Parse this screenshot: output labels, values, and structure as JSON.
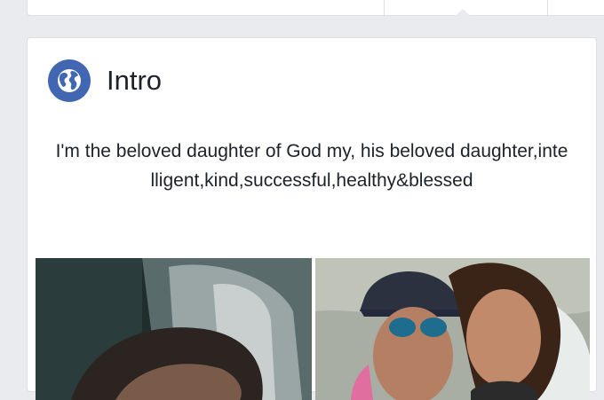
{
  "top_bar": {
    "active_tab_caret": true
  },
  "intro": {
    "title": "Intro",
    "icon": "globe-icon",
    "bio": "I'm the beloved daughter of God my, his beloved daughter,intelligent,kind,successful,healthy&blessed"
  },
  "photos": [
    {
      "description_icon": "photo-car-selfie"
    },
    {
      "description_icon": "photo-beach-selfie"
    }
  ],
  "colors": {
    "accent": "#4267b2",
    "text": "#1d2129",
    "page_bg": "#e9ebee",
    "card_border": "#dddfe2"
  }
}
